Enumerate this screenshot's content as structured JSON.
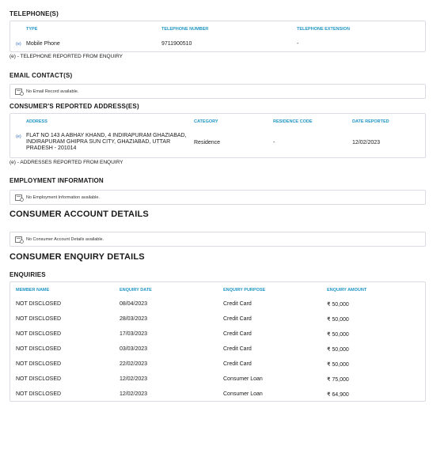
{
  "telephone": {
    "heading": "TELEPHONE(S)",
    "columns": [
      "TYPE",
      "TELEPHONE NUMBER",
      "TELEPHONE EXTENSION"
    ],
    "row": {
      "tag": "(e)",
      "type": "Mobile Phone",
      "number": "9711900510",
      "extension": "-"
    },
    "note": "(e) - TELEPHONE REPORTED FROM ENQUIRY"
  },
  "email": {
    "heading": "EMAIL CONTACT(S)",
    "empty_text": "No Email Record available."
  },
  "address": {
    "heading": "CONSUMER'S REPORTED ADDRESS(ES)",
    "columns": [
      "ADDRESS",
      "CATEGORY",
      "RESIDENCE CODE",
      "DATE REPORTED"
    ],
    "row": {
      "tag": "(e)",
      "address_line1": "FLAT NO 143 A ABHAY KHAND, 4 INDIRAPURAM GHAZIABAD,",
      "address_line2": "INDIRAPURAM GHIPRA SUN CITY, GHAZIABAD, UTTAR",
      "address_line3": "PRADESH - 201014",
      "category": "Residence",
      "residence_code": "-",
      "date_reported": "12/02/2023"
    },
    "note": "(e) - ADDRESSES REPORTED FROM ENQUIRY"
  },
  "employment": {
    "heading": "EMPLOYMENT INFORMATION",
    "empty_text": "No Employment Information available."
  },
  "account_details": {
    "heading": "CONSUMER ACCOUNT DETAILS",
    "empty_text": "No Consumer Account Details available."
  },
  "enquiry_details": {
    "heading": "CONSUMER ENQUIRY DETAILS",
    "sub_heading": "ENQUIRIES",
    "columns": [
      "MEMBER NAME",
      "ENQUIRY DATE",
      "ENQUIRY PURPOSE",
      "ENQUIRY AMOUNT"
    ],
    "rows": [
      {
        "member": "NOT DISCLOSED",
        "date": "08/04/2023",
        "purpose": "Credit Card",
        "amount": "₹ 50,000"
      },
      {
        "member": "NOT DISCLOSED",
        "date": "28/03/2023",
        "purpose": "Credit Card",
        "amount": "₹ 50,000"
      },
      {
        "member": "NOT DISCLOSED",
        "date": "17/03/2023",
        "purpose": "Credit Card",
        "amount": "₹ 50,000"
      },
      {
        "member": "NOT DISCLOSED",
        "date": "03/03/2023",
        "purpose": "Credit Card",
        "amount": "₹ 50,000"
      },
      {
        "member": "NOT DISCLOSED",
        "date": "22/02/2023",
        "purpose": "Credit Card",
        "amount": "₹ 50,000"
      },
      {
        "member": "NOT DISCLOSED",
        "date": "12/02/2023",
        "purpose": "Consumer Loan",
        "amount": "₹ 75,000"
      },
      {
        "member": "NOT DISCLOSED",
        "date": "12/02/2023",
        "purpose": "Consumer Loan",
        "amount": "₹ 64,900"
      }
    ]
  },
  "icons": {
    "empty_record": "document-icon"
  },
  "colors": {
    "header_blue": "#2196c4",
    "tag_blue": "#2a6cc4",
    "border": "#d9dde3"
  }
}
